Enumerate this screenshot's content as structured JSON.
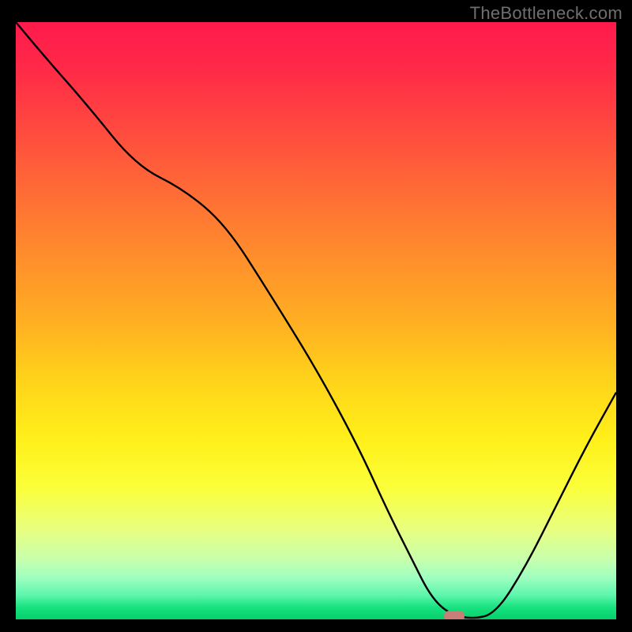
{
  "watermark": "TheBottleneck.com",
  "colors": {
    "frame_bg": "#000000",
    "curve": "#000000",
    "marker": "#c97f78",
    "gradient_stops": [
      "#ff1a4d",
      "#ff2a47",
      "#ff4a3f",
      "#ff6a36",
      "#ff8a2d",
      "#ffae22",
      "#ffd31a",
      "#fff01a",
      "#fbff3a",
      "#e8ff80",
      "#c7ffad",
      "#9fffc0",
      "#5cf5ab",
      "#18e27f",
      "#06d06c"
    ]
  },
  "chart_data": {
    "type": "line",
    "title": "",
    "xlabel": "",
    "ylabel": "",
    "xlim": [
      0,
      100
    ],
    "ylim": [
      0,
      100
    ],
    "x": [
      0,
      5,
      12,
      20,
      28,
      35,
      42,
      50,
      57,
      62,
      66,
      69,
      72,
      76,
      80,
      85,
      90,
      95,
      100
    ],
    "y": [
      100,
      94,
      86,
      76,
      72,
      66,
      55,
      42,
      29,
      18,
      10,
      4,
      1,
      0,
      1,
      9,
      19,
      29,
      38
    ],
    "marker": {
      "x": 73,
      "y": 0
    },
    "note": "y is bottleneck-style metric (100=worst red, 0=best green); curve dips to ~0 near x≈72–76 then rises"
  }
}
